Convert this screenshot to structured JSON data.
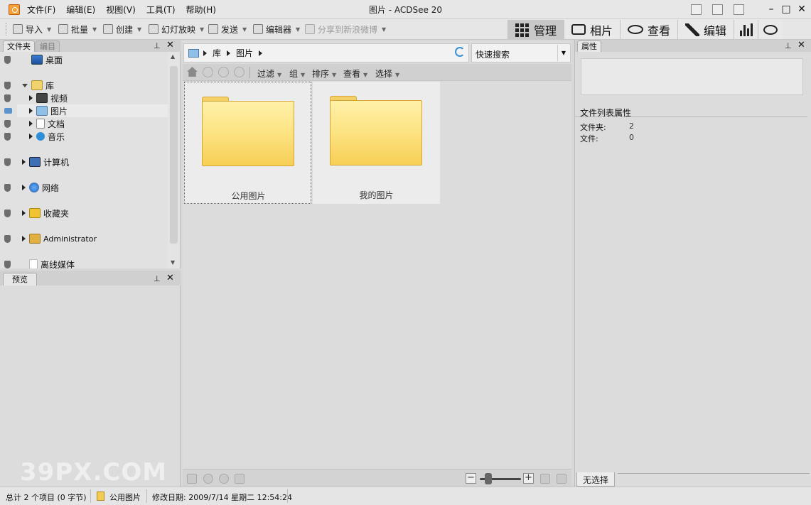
{
  "window": {
    "title": "图片 - ACDSee 20",
    "menu": [
      "文件(F)",
      "编辑(E)",
      "视图(V)",
      "工具(T)",
      "帮助(H)"
    ]
  },
  "toolbar": {
    "items": [
      "导入",
      "批量",
      "创建",
      "幻灯放映",
      "发送",
      "编辑器",
      "分享到新浪微博"
    ],
    "modes": [
      "管理",
      "相片",
      "查看",
      "编辑"
    ],
    "active_mode": "管理"
  },
  "folders_panel": {
    "tabs": [
      "文件夹",
      "编目"
    ],
    "pin": "ꟸ",
    "close": "✕",
    "tree": [
      "桌面",
      "库",
      "视频",
      "图片",
      "文档",
      "音乐",
      "计算机",
      "网络",
      "收藏夹",
      "Administrator",
      "离线媒体"
    ],
    "selected": "图片"
  },
  "preview_panel": {
    "tab": "预览"
  },
  "address_bar": {
    "crumbs": [
      "库",
      "图片"
    ],
    "quick_search": "快速搜索"
  },
  "center_toolbar": {
    "items": [
      "过滤",
      "组",
      "排序",
      "查看",
      "选择"
    ]
  },
  "file_list": {
    "items": [
      "公用图片",
      "我的图片"
    ]
  },
  "properties_panel": {
    "tab": "属性",
    "section_title": "文件列表属性",
    "rows": [
      {
        "label": "文件夹:",
        "value": "2"
      },
      {
        "label": "文件:",
        "value": "0"
      }
    ],
    "bottom_tab": "无选择"
  },
  "status_bar": {
    "summary": "总计 2 个项目 (0 字节)",
    "current": "公用图片",
    "modified": "修改日期: 2009/7/14 星期二 12:54:24"
  },
  "watermark": "39PX.COM",
  "colors": {
    "folder_yellow": "#f7cf55",
    "accent_blue": "#3a8fd8",
    "selection": "#eaeaea"
  }
}
